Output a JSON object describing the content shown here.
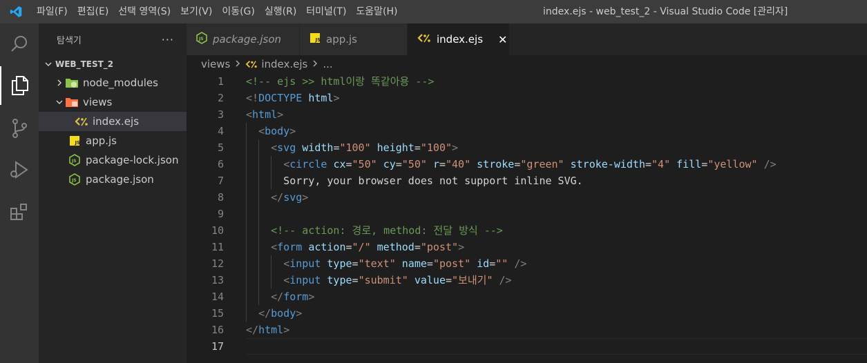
{
  "titlebar": {
    "menu": [
      "파일(F)",
      "편집(E)",
      "선택 영역(S)",
      "보기(V)",
      "이동(G)",
      "실행(R)",
      "터미널(T)",
      "도움말(H)"
    ],
    "window_title": "index.ejs - web_test_2 - Visual Studio Code [관리자]"
  },
  "sidebar": {
    "title": "탐색기",
    "more": "···",
    "section": "WEB_TEST_2",
    "items": [
      {
        "label": "node_modules",
        "icon": "folder-node-icon"
      },
      {
        "label": "views",
        "icon": "folder-views-icon"
      },
      {
        "label": "index.ejs",
        "icon": "ejs-file-icon"
      },
      {
        "label": "app.js",
        "icon": "js-file-icon"
      },
      {
        "label": "package-lock.json",
        "icon": "nodejs-file-icon"
      },
      {
        "label": "package.json",
        "icon": "nodejs-file-icon"
      }
    ]
  },
  "tabs": [
    {
      "label": "package.json",
      "icon": "nodejs-file-icon"
    },
    {
      "label": "app.js",
      "icon": "js-file-icon"
    },
    {
      "label": "index.ejs",
      "icon": "ejs-file-icon",
      "close": "✕"
    }
  ],
  "breadcrumb": {
    "folder": "views",
    "file": "index.ejs",
    "tail": "..."
  },
  "editor": {
    "current_line": 17,
    "lines": [
      [
        [
          "com",
          "<!-- ejs >> html이랑 똑같아용 -->"
        ]
      ],
      [
        [
          "br",
          "<!"
        ],
        [
          "tag",
          "DOCTYPE"
        ],
        [
          "txt",
          " "
        ],
        [
          "attr",
          "html"
        ],
        [
          "br",
          ">"
        ]
      ],
      [
        [
          "br",
          "<"
        ],
        [
          "tag",
          "html"
        ],
        [
          "br",
          ">"
        ]
      ],
      [
        [
          "txt",
          "  "
        ],
        [
          "br",
          "<"
        ],
        [
          "tag",
          "body"
        ],
        [
          "br",
          ">"
        ]
      ],
      [
        [
          "txt",
          "    "
        ],
        [
          "br",
          "<"
        ],
        [
          "tag",
          "svg"
        ],
        [
          "txt",
          " "
        ],
        [
          "attr",
          "width"
        ],
        [
          "txt",
          "="
        ],
        [
          "str",
          "\"100\""
        ],
        [
          "txt",
          " "
        ],
        [
          "attr",
          "height"
        ],
        [
          "txt",
          "="
        ],
        [
          "str",
          "\"100\""
        ],
        [
          "br",
          ">"
        ]
      ],
      [
        [
          "txt",
          "      "
        ],
        [
          "br",
          "<"
        ],
        [
          "tag",
          "circle"
        ],
        [
          "txt",
          " "
        ],
        [
          "attr",
          "cx"
        ],
        [
          "txt",
          "="
        ],
        [
          "str",
          "\"50\""
        ],
        [
          "txt",
          " "
        ],
        [
          "attr",
          "cy"
        ],
        [
          "txt",
          "="
        ],
        [
          "str",
          "\"50\""
        ],
        [
          "txt",
          " "
        ],
        [
          "attr",
          "r"
        ],
        [
          "txt",
          "="
        ],
        [
          "str",
          "\"40\""
        ],
        [
          "txt",
          " "
        ],
        [
          "attr",
          "stroke"
        ],
        [
          "txt",
          "="
        ],
        [
          "str",
          "\"green\""
        ],
        [
          "txt",
          " "
        ],
        [
          "attr",
          "stroke-width"
        ],
        [
          "txt",
          "="
        ],
        [
          "str",
          "\"4\""
        ],
        [
          "txt",
          " "
        ],
        [
          "attr",
          "fill"
        ],
        [
          "txt",
          "="
        ],
        [
          "str",
          "\"yellow\""
        ],
        [
          "txt",
          " "
        ],
        [
          "br",
          "/>"
        ]
      ],
      [
        [
          "txt",
          "      Sorry, your browser does not support inline SVG."
        ]
      ],
      [
        [
          "txt",
          "    "
        ],
        [
          "br",
          "</"
        ],
        [
          "tag",
          "svg"
        ],
        [
          "br",
          ">"
        ]
      ],
      [
        [
          "txt",
          ""
        ]
      ],
      [
        [
          "txt",
          "    "
        ],
        [
          "com",
          "<!-- action: 경로, method: 전달 방식 -->"
        ]
      ],
      [
        [
          "txt",
          "    "
        ],
        [
          "br",
          "<"
        ],
        [
          "tag",
          "form"
        ],
        [
          "txt",
          " "
        ],
        [
          "attr",
          "action"
        ],
        [
          "txt",
          "="
        ],
        [
          "str",
          "\"/\""
        ],
        [
          "txt",
          " "
        ],
        [
          "attr",
          "method"
        ],
        [
          "txt",
          "="
        ],
        [
          "str",
          "\"post\""
        ],
        [
          "br",
          ">"
        ]
      ],
      [
        [
          "txt",
          "      "
        ],
        [
          "br",
          "<"
        ],
        [
          "tag",
          "input"
        ],
        [
          "txt",
          " "
        ],
        [
          "attr",
          "type"
        ],
        [
          "txt",
          "="
        ],
        [
          "str",
          "\"text\""
        ],
        [
          "txt",
          " "
        ],
        [
          "attr",
          "name"
        ],
        [
          "txt",
          "="
        ],
        [
          "str",
          "\"post\""
        ],
        [
          "txt",
          " "
        ],
        [
          "attr",
          "id"
        ],
        [
          "txt",
          "="
        ],
        [
          "str",
          "\"\""
        ],
        [
          "txt",
          " "
        ],
        [
          "br",
          "/>"
        ]
      ],
      [
        [
          "txt",
          "      "
        ],
        [
          "br",
          "<"
        ],
        [
          "tag",
          "input"
        ],
        [
          "txt",
          " "
        ],
        [
          "attr",
          "type"
        ],
        [
          "txt",
          "="
        ],
        [
          "str",
          "\"submit\""
        ],
        [
          "txt",
          " "
        ],
        [
          "attr",
          "value"
        ],
        [
          "txt",
          "="
        ],
        [
          "str",
          "\"보내기\""
        ],
        [
          "txt",
          " "
        ],
        [
          "br",
          "/>"
        ]
      ],
      [
        [
          "txt",
          "    "
        ],
        [
          "br",
          "</"
        ],
        [
          "tag",
          "form"
        ],
        [
          "br",
          ">"
        ]
      ],
      [
        [
          "txt",
          "  "
        ],
        [
          "br",
          "</"
        ],
        [
          "tag",
          "body"
        ],
        [
          "br",
          ">"
        ]
      ],
      [
        [
          "br",
          "</"
        ],
        [
          "tag",
          "html"
        ],
        [
          "br",
          ">"
        ]
      ],
      [
        [
          "txt",
          ""
        ]
      ]
    ]
  },
  "colors": {
    "accent": "#007acc",
    "js_yellow": "#f5de19",
    "node_green": "#8bc34a",
    "ejs_yellow": "#e8c33c"
  }
}
